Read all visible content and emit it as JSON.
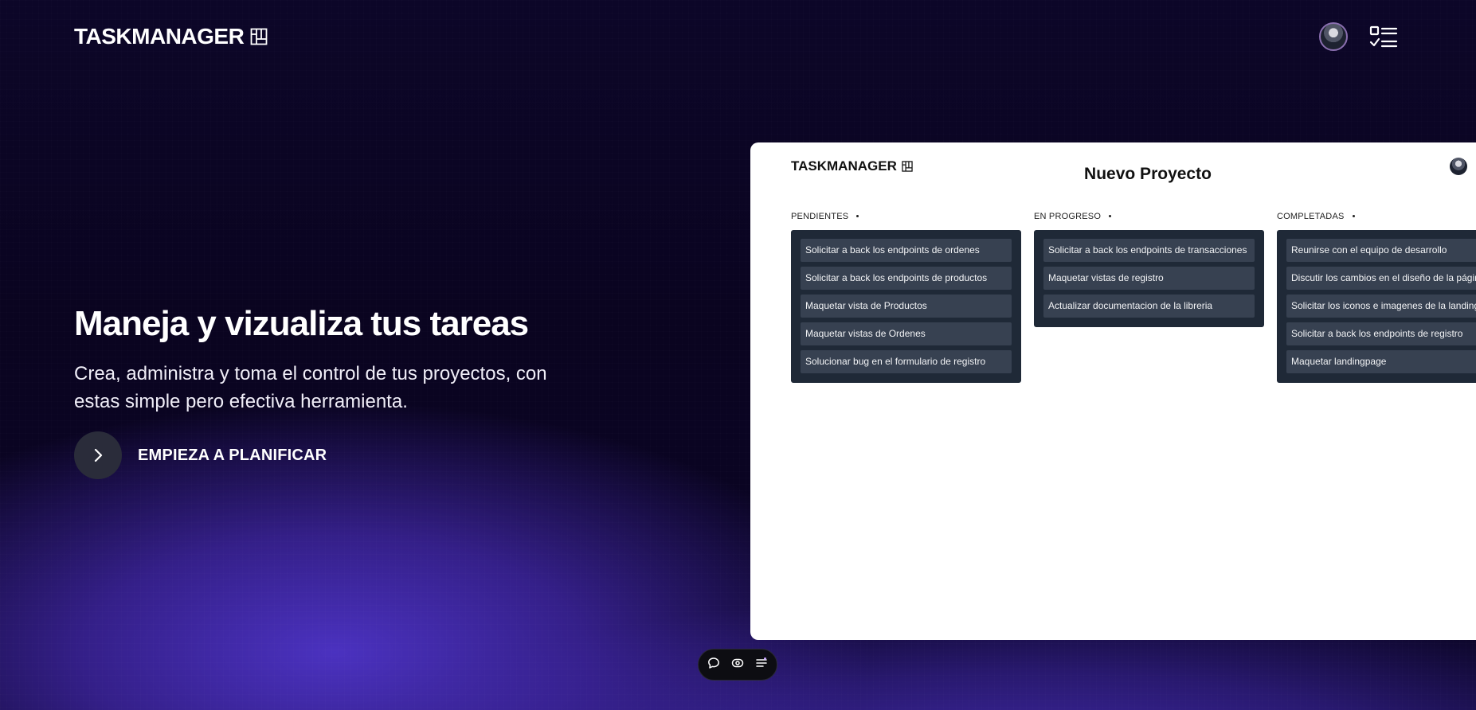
{
  "header": {
    "logo_text": "TASKMANAGER"
  },
  "hero": {
    "title": "Maneja y vizualiza tus tareas",
    "subtitle": "Crea, administra y toma el control de tus proyectos, con estas simple pero efectiva herramienta.",
    "cta_label": "EMPIEZA A PLANIFICAR"
  },
  "preview": {
    "logo_text": "TASKMANAGER",
    "project_title": "Nuevo Proyecto",
    "columns": [
      {
        "title": "PENDIENTES",
        "tasks": [
          "Solicitar a back los endpoints de ordenes",
          "Solicitar a back los endpoints de productos",
          "Maquetar vista de Productos",
          "Maquetar vistas de Ordenes",
          "Solucionar bug en el formulario de registro"
        ]
      },
      {
        "title": "EN PROGRESO",
        "tasks": [
          "Solicitar a back los endpoints de transacciones",
          "Maquetar vistas de registro",
          "Actualizar documentacion de la libreria"
        ]
      },
      {
        "title": "COMPLETADAS",
        "tasks": [
          "Reunirse con el equipo de desarrollo",
          "Discutir los cambios en el diseño de la página",
          "Solicitar los iconos e imagenes de la landingpage",
          "Solicitar a back los endpoints de registro",
          "Maquetar landingpage"
        ]
      }
    ]
  },
  "icons": {
    "logo": "board-icon",
    "menu": "checklist-icon",
    "cta": "chevron-right-icon",
    "toolbar": [
      "comment-icon",
      "eye-icon",
      "sliders-icon"
    ]
  },
  "colors": {
    "background": "#0b0524",
    "accent_purple": "#4b32c3",
    "task_column": "#1f2937",
    "task_card": "#374151"
  }
}
